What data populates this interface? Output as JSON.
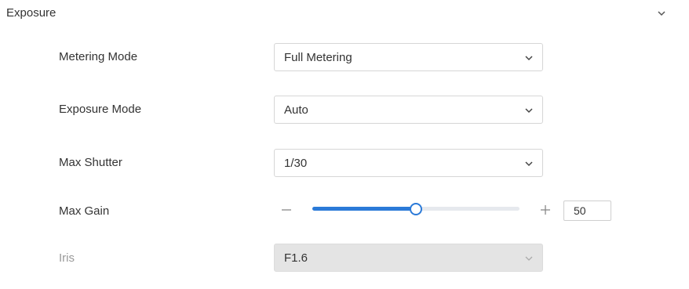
{
  "section": {
    "title": "Exposure",
    "expand_icon": "chevron-down-icon"
  },
  "fields": {
    "metering_mode": {
      "label": "Metering Mode",
      "value": "Full Metering",
      "icon": "chevron-down-icon"
    },
    "exposure_mode": {
      "label": "Exposure Mode",
      "value": "Auto",
      "icon": "chevron-down-icon"
    },
    "max_shutter": {
      "label": "Max Shutter",
      "value": "1/30",
      "icon": "chevron-down-icon"
    },
    "max_gain": {
      "label": "Max Gain",
      "value": "50",
      "min": 0,
      "max": 100,
      "decrement_icon": "minus-icon",
      "increment_icon": "plus-icon"
    },
    "iris": {
      "label": "Iris",
      "value": "F1.6",
      "disabled": true,
      "icon": "chevron-down-icon"
    }
  },
  "colors": {
    "accent": "#2b7ad8",
    "track": "#e6e9ee",
    "disabled_bg": "#e4e4e4",
    "disabled_text": "#999999"
  }
}
